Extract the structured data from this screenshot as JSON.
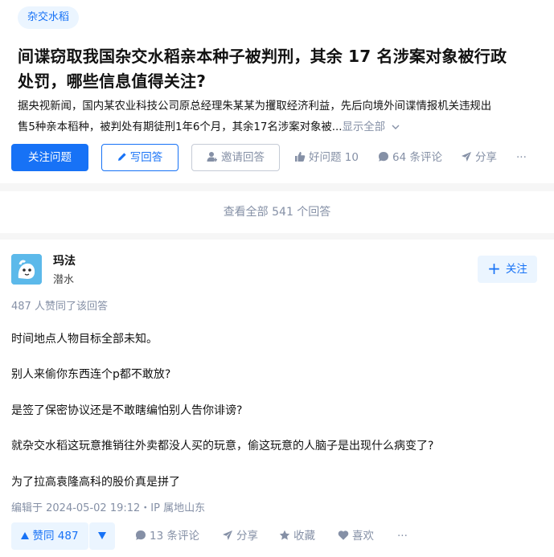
{
  "question": {
    "topic_tag": "杂交水稻",
    "title_line1": "间谍窃取我国杂交水稻亲本种子被判刑，其余 17 名涉案对象被行政",
    "title_line2": "处罚，哪些信息值得关注?",
    "excerpt_line1": "据央视新闻，国内某农业科技公司原总经理朱某某为攫取经济利益，先后向境外间谍情报机关违规出",
    "excerpt_line2": "售5种亲本稻种，被判处有期徒刑1年6个月，其余17名涉案对象被...",
    "show_all": "显示全部",
    "actions": {
      "follow_question": "关注问题",
      "write_answer": "写回答",
      "invite_answer": "邀请回答",
      "good_question": "好问题 10",
      "comments": "64 条评论",
      "share": "分享",
      "more": "···"
    }
  },
  "view_all_answers": "查看全部 541 个回答",
  "answer": {
    "author_name": "玛法",
    "author_bio": "潜水",
    "follow": "关注",
    "upvote_info": "487 人赞同了该回答",
    "paragraphs": [
      "时间地点人物目标全部未知。",
      "别人来偷你东西连个p都不敢放?",
      "是签了保密协议还是不敢瞎编怕别人告你诽谤?",
      "就杂交水稻这玩意推销往外卖都没人买的玩意，偷这玩意的人脑子是出现什么病变了?",
      "为了拉高袁隆高科的股价真是拼了"
    ],
    "edit_time": "编辑于 2024-05-02 19:12・IP 属地山东",
    "actions": {
      "upvote": "赞同 487",
      "comments": "13 条评论",
      "share": "分享",
      "favorite": "收藏",
      "like": "喜欢",
      "more": "···"
    }
  },
  "colors": {
    "primary": "#1772f6",
    "primary_light": "#ebf5ff",
    "meta_grey": "#8590a6",
    "background": "#f6f6f6"
  },
  "icons": [
    "pencil-icon",
    "invite-user-icon",
    "thumb-up-icon",
    "comment-icon",
    "share-plane-icon",
    "chevron-down-icon",
    "plus-icon",
    "triangle-up-icon",
    "triangle-down-icon",
    "star-icon",
    "heart-icon"
  ]
}
